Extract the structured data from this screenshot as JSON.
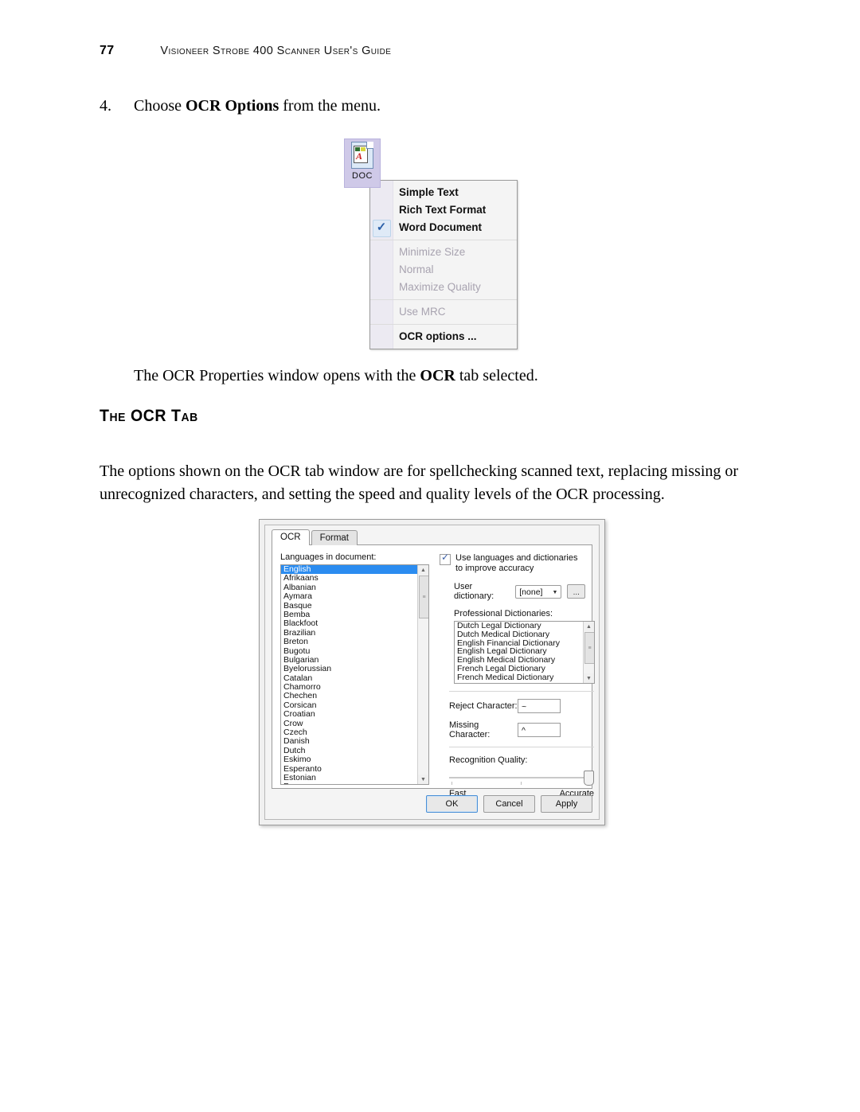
{
  "header": {
    "page_number": "77",
    "title": "Visioneer Strobe 400 Scanner User's Guide"
  },
  "step": {
    "number": "4.",
    "text_before": "Choose ",
    "text_bold": "OCR Options",
    "text_after": " from the menu."
  },
  "context_menu": {
    "icon": {
      "label": "DOC",
      "icon_name": "document-ocr-icon"
    },
    "groups": [
      {
        "items": [
          {
            "label": "Simple Text",
            "checked": false,
            "disabled": false
          },
          {
            "label": "Rich Text Format",
            "checked": false,
            "disabled": false
          },
          {
            "label": "Word Document",
            "checked": true,
            "disabled": false
          }
        ]
      },
      {
        "items": [
          {
            "label": "Minimize Size",
            "checked": false,
            "disabled": true
          },
          {
            "label": "Normal",
            "checked": false,
            "disabled": true
          },
          {
            "label": "Maximize Quality",
            "checked": false,
            "disabled": true
          }
        ]
      },
      {
        "items": [
          {
            "label": "Use MRC",
            "checked": false,
            "disabled": true
          }
        ]
      },
      {
        "items": [
          {
            "label": "OCR options ...",
            "checked": false,
            "disabled": false
          }
        ]
      }
    ],
    "check_glyph": "✓"
  },
  "paragraphs": {
    "after_menu_before": "The OCR Properties window opens with the ",
    "after_menu_bold": "OCR",
    "after_menu_after": " tab selected.",
    "section_heading": "The OCR Tab",
    "intro": "The options shown on the OCR tab window are for spellchecking scanned text, replacing missing or unrecognized characters, and setting the speed and quality levels of the OCR processing."
  },
  "dialog": {
    "tabs": [
      {
        "label": "OCR",
        "active": true
      },
      {
        "label": "Format",
        "active": false
      }
    ],
    "languages_label": "Languages in document:",
    "languages": [
      "English",
      "Afrikaans",
      "Albanian",
      "Aymara",
      "Basque",
      "Bemba",
      "Blackfoot",
      "Brazilian",
      "Breton",
      "Bugotu",
      "Bulgarian",
      "Byelorussian",
      "Catalan",
      "Chamorro",
      "Chechen",
      "Corsican",
      "Croatian",
      "Crow",
      "Czech",
      "Danish",
      "Dutch",
      "Eskimo",
      "Esperanto",
      "Estonian",
      "Faroese"
    ],
    "languages_selected": "English",
    "use_dictionaries_label": "Use languages and dictionaries to improve accuracy",
    "use_dictionaries_checked": true,
    "user_dictionary_label": "User dictionary:",
    "user_dictionary_value": "[none]",
    "browse_button_label": "...",
    "professional_dictionaries_label": "Professional Dictionaries:",
    "professional_dictionaries": [
      "Dutch Legal Dictionary",
      "Dutch Medical Dictionary",
      "English Financial Dictionary",
      "English Legal Dictionary",
      "English Medical Dictionary",
      "French Legal Dictionary",
      "French Medical Dictionary"
    ],
    "reject_character_label": "Reject Character:",
    "reject_character_value": "~",
    "missing_character_label": "Missing Character:",
    "missing_character_value": "^",
    "recognition_quality_label": "Recognition Quality:",
    "recognition_quality_min_label": "Fast",
    "recognition_quality_max_label": "Accurate",
    "recognition_quality_value": 100,
    "buttons": [
      {
        "label": "OK",
        "default": true
      },
      {
        "label": "Cancel",
        "default": false
      },
      {
        "label": "Apply",
        "default": false
      }
    ]
  },
  "colors": {
    "selection_blue": "#2b8cf0",
    "check_blue": "#2a5fa8",
    "icon_highlight": "#cfc9e8",
    "dialog_face": "#f0f0f0"
  }
}
